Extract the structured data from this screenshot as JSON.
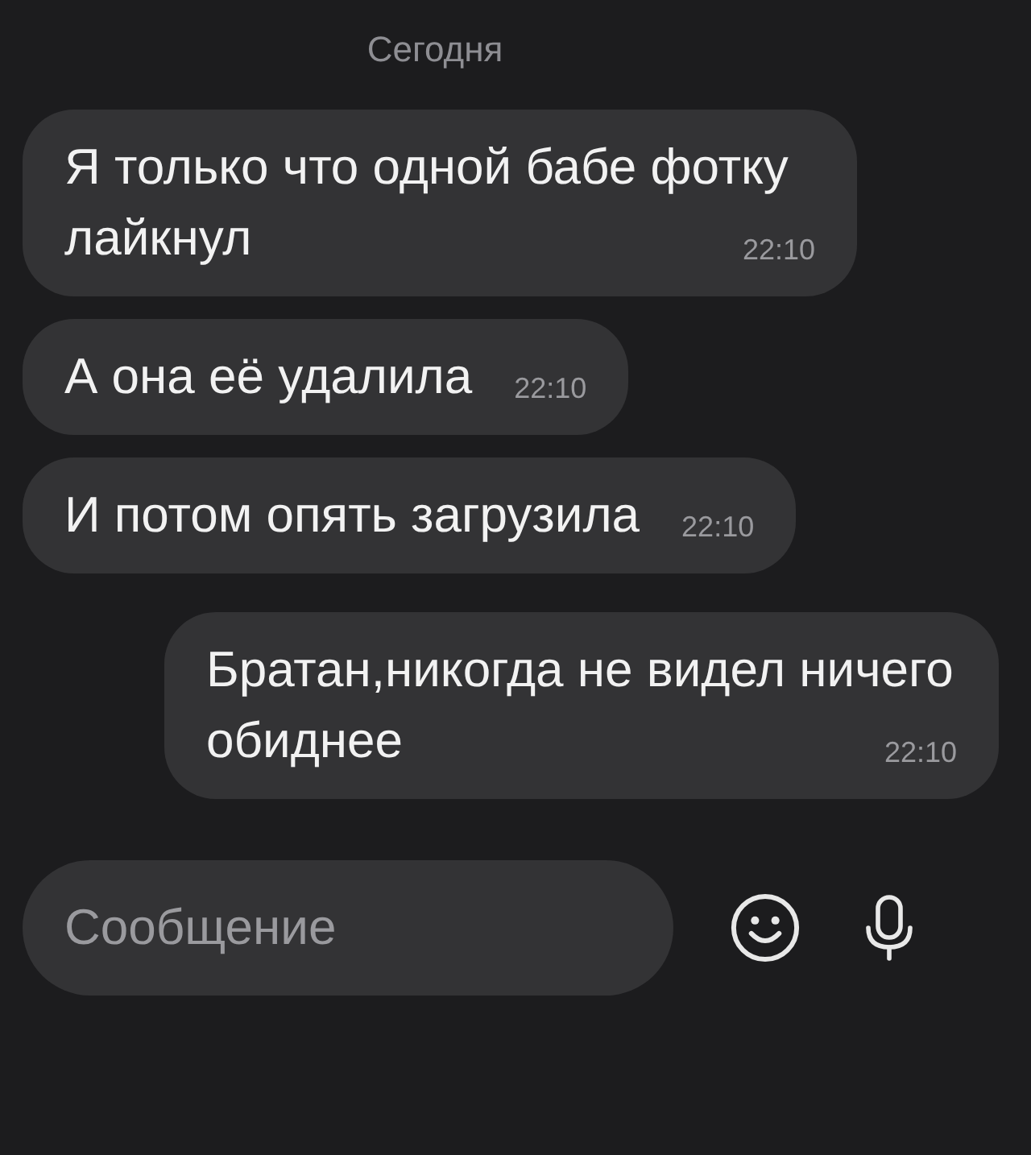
{
  "date_divider": "Сегодня",
  "messages": [
    {
      "kind": "incoming",
      "text": "Я только что одной бабе фотку лайкнул",
      "time": "22:10"
    },
    {
      "kind": "incoming",
      "text": "А она её удалила",
      "time": "22:10"
    },
    {
      "kind": "incoming",
      "text": "И потом опять загрузила",
      "time": "22:10"
    },
    {
      "kind": "outgoing",
      "text": "Братан,никогда не видел ничего обиднее",
      "time": "22:10"
    }
  ],
  "composer": {
    "placeholder": "Сообщение"
  }
}
